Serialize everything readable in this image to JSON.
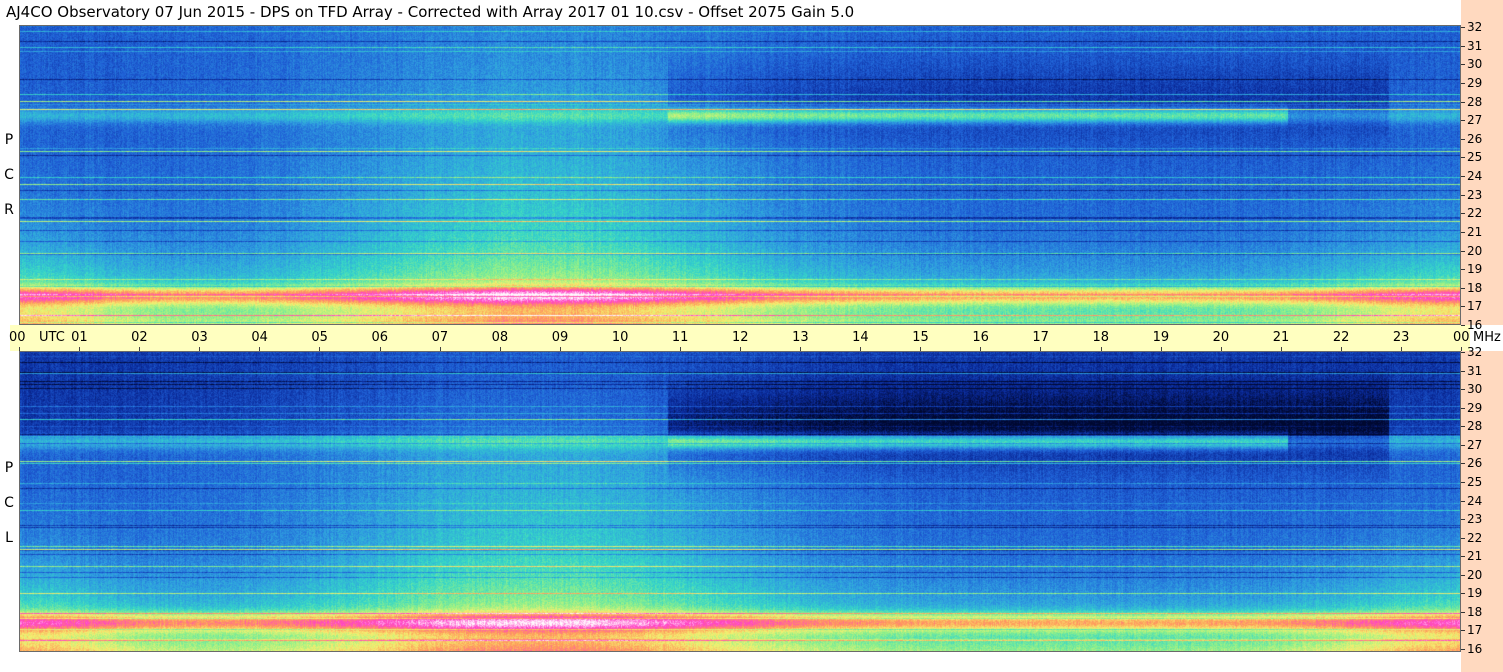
{
  "title": "AJ4CO Observatory  07 Jun 2015  -  DPS on TFD Array  -  Corrected with Array 2017 01 10.csv  -  Offset 2075  Gain 5.0",
  "chart_data": {
    "type": "heatmap",
    "title": "AJ4CO Observatory  07 Jun 2015  -  DPS on TFD Array  -  Corrected with Array 2017 01 10.csv  -  Offset 2075  Gain 5.0",
    "x_axis": {
      "unit_label": "UTC",
      "range": [
        "00",
        "00"
      ],
      "tick_labels": [
        "00",
        "01",
        "02",
        "03",
        "04",
        "05",
        "06",
        "07",
        "08",
        "09",
        "10",
        "11",
        "12",
        "13",
        "14",
        "15",
        "16",
        "17",
        "18",
        "19",
        "20",
        "21",
        "22",
        "23",
        "00"
      ]
    },
    "y_axis": {
      "unit_label": "MHz",
      "ylim": [
        16,
        32
      ],
      "tick_labels": [
        32,
        31,
        30,
        29,
        28,
        27,
        26,
        25,
        24,
        23,
        22,
        21,
        20,
        19,
        18,
        17,
        16
      ]
    },
    "panels": [
      {
        "name": "RCP",
        "label_letters": [
          "R",
          "C",
          "P"
        ]
      },
      {
        "name": "LCP",
        "label_letters": [
          "L",
          "C",
          "P"
        ]
      }
    ],
    "colormap": [
      "#000830",
      "#0a2a9a",
      "#1f5fd6",
      "#2f9ee0",
      "#35d6c8",
      "#8ff08a",
      "#f4f070",
      "#ff9a5a",
      "#ff40c8",
      "#ffffff"
    ]
  }
}
